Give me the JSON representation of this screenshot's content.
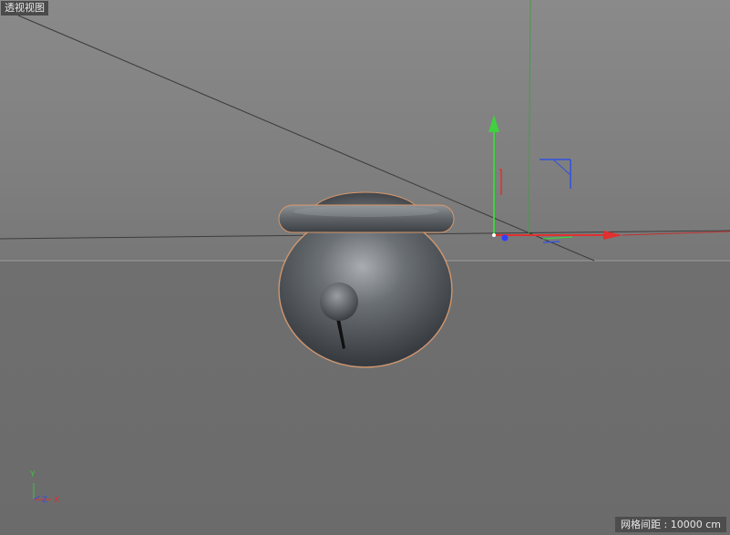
{
  "viewport": {
    "view_name": "透视视图",
    "grid_spacing": "网格间距 : 10000 cm"
  },
  "axis_indicator": {
    "y_label": "Y",
    "z_label": "Z",
    "x_label": "X"
  },
  "colors": {
    "x_axis": "#e03030",
    "y_axis": "#30c030",
    "z_axis": "#3050e0",
    "selection_outline": "#d9976a",
    "bell_body": "#50565c"
  },
  "scene_objects": [
    "bell-model",
    "move-gizmo",
    "camera-crosshair"
  ]
}
